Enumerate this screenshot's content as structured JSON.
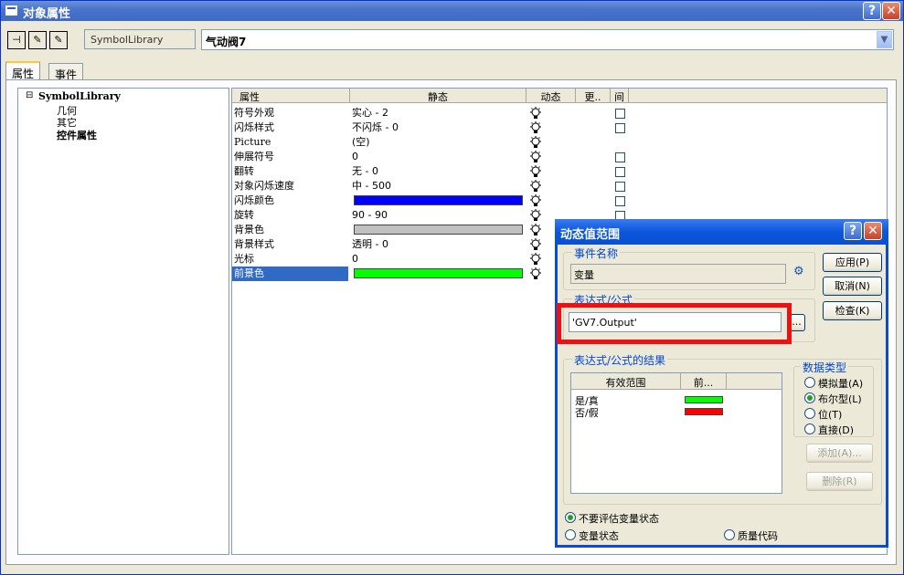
{
  "window": {
    "title": "对象属性"
  },
  "toolbar": {
    "pin_label": "⊣¤",
    "lib_name": "SymbolLibrary",
    "object_name": "气动阀7"
  },
  "tabs": [
    {
      "label": "属性"
    },
    {
      "label": "事件"
    }
  ],
  "tree": {
    "root": "SymbolLibrary",
    "root_toggle": "⊟",
    "children": [
      {
        "label": "几何"
      },
      {
        "label": "其它"
      },
      {
        "label": "控件属性"
      }
    ]
  },
  "grid": {
    "headers": {
      "property": "属性",
      "static": "静态",
      "dynamic": "动态",
      "update": "更..",
      "indirect": "间"
    },
    "rows": [
      {
        "name": "符号外观",
        "value": "实心 - 2"
      },
      {
        "name": "闪烁样式",
        "value": "不闪烁 - 0"
      },
      {
        "name": "Picture",
        "value": "(空)"
      },
      {
        "name": "伸展符号",
        "value": "0"
      },
      {
        "name": "翻转",
        "value": "无 - 0"
      },
      {
        "name": "对象闪烁速度",
        "value": "中 - 500"
      },
      {
        "name": "闪烁颜色",
        "value": "",
        "color": "#0000ff"
      },
      {
        "name": "旋转",
        "value": "90 - 90"
      },
      {
        "name": "背景色",
        "value": "",
        "color": "#c0c0c0"
      },
      {
        "name": "背景样式",
        "value": "透明 - 0"
      },
      {
        "name": "光标",
        "value": "0"
      },
      {
        "name": "前景色",
        "value": "",
        "color": "#00ff00"
      }
    ]
  },
  "dialog": {
    "title": "动态值范围",
    "event_group": "事件名称",
    "event_value": "变量",
    "expr_group": "表达式/公式",
    "expr_value": "'GV7.Output'",
    "browse_label": "...",
    "result_group": "表达式/公式的结果",
    "result_headers": {
      "range": "有效范围",
      "fore": "前..."
    },
    "results": [
      {
        "label": "是/真",
        "color": "#00ff00"
      },
      {
        "label": "否/假",
        "color": "#ff0000"
      }
    ],
    "buttons": {
      "apply": "应用(P)",
      "cancel": "取消(N)",
      "check": "检查(K)",
      "add": "添加(A)...",
      "delete": "删除(R)"
    },
    "datatype_group": "数据类型",
    "datatypes": [
      {
        "label": "模拟量(A)",
        "selected": false
      },
      {
        "label": "布尔型(L)",
        "selected": true
      },
      {
        "label": "位(T)",
        "selected": false
      },
      {
        "label": "直接(D)",
        "selected": false
      }
    ],
    "eval": {
      "no_eval": "不要评估变量状态",
      "var_status": "变量状态",
      "quality_code": "质量代码"
    }
  },
  "colors": {
    "highlight_box": "#ee1111",
    "selected_row": "#316ac5"
  }
}
